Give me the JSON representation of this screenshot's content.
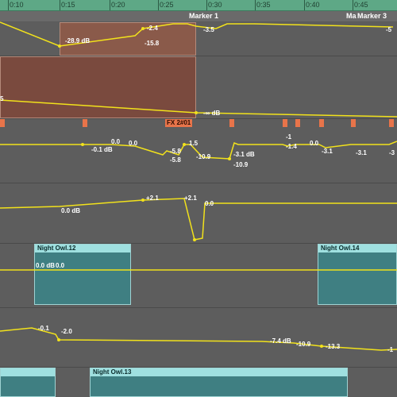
{
  "timeline": {
    "ticks": [
      "0:10",
      "0:15",
      "0:20",
      "0:25",
      "0:30",
      "0:35",
      "0:40",
      "0:45"
    ]
  },
  "markers": {
    "marker1": "Marker 1",
    "marker3_prefix": "Ma",
    "marker3": "Marker 3"
  },
  "lane1": {
    "labels": [
      "-28.9 dB",
      "-2.4",
      "-15.8",
      "-3.5",
      "-5"
    ]
  },
  "lane2": {
    "labels": [
      "5",
      "-∞ dB"
    ]
  },
  "lane3": {
    "fx_label": "FX 2#01",
    "labels": [
      "-0.1 dB",
      "0.0",
      "0.0",
      "1.5",
      "-5.8",
      "-5.8",
      "-10.9",
      "-3.1 dB",
      "-10.9",
      "-3.1",
      "-1",
      "0.0",
      "-1.4",
      "-3.1",
      "-3"
    ]
  },
  "lane4": {
    "labels": [
      "+2.1",
      "+2.1",
      "0.0 dB",
      "0.0"
    ]
  },
  "lane5": {
    "clip_a": "Night Owl.12",
    "clip_b": "Night Owl.14",
    "labels": [
      "0.0 dB",
      "0.0"
    ]
  },
  "lane6": {
    "labels": [
      "-0.1",
      "-2.0",
      "-7.4 dB",
      "-10.9",
      "-13.3",
      "-1"
    ]
  },
  "lane7": {
    "clip_a": "Night Owl.13"
  },
  "colors": {
    "automation": "#f2e21b",
    "clip_teal": "#3f7f82",
    "clip_header": "#9fe0e0",
    "ruler": "#5ea886",
    "flag": "#e8744a"
  }
}
